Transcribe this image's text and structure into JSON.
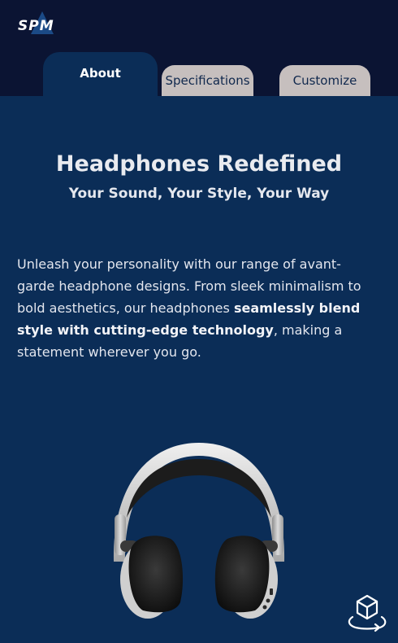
{
  "header": {
    "logo_text": "SPM"
  },
  "tabs": [
    {
      "label": "About",
      "active": true
    },
    {
      "label": "Specifications",
      "active": false
    },
    {
      "label": "Customize",
      "active": false
    }
  ],
  "main": {
    "title": "Headphones Redefined",
    "subtitle": "Your Sound, Your Style, Your Way",
    "paragraph_part1": "Unleash your personality with our range of avant-garde headphone designs. From sleek minimalism to bold aesthetics, our headphones ",
    "paragraph_bold": "seamlessly blend style with cutting-edge technology",
    "paragraph_part2": ", making a statement wherever you go."
  },
  "product": {
    "icon": "headphones-image"
  },
  "viewer": {
    "icon": "ar-view-icon"
  },
  "colors": {
    "header_bg": "#0b1433",
    "page_bg": "#0b2d57",
    "inactive_tab_bg": "#c6bfbe",
    "inactive_tab_text": "#10284d",
    "text": "#e3e6ee"
  }
}
